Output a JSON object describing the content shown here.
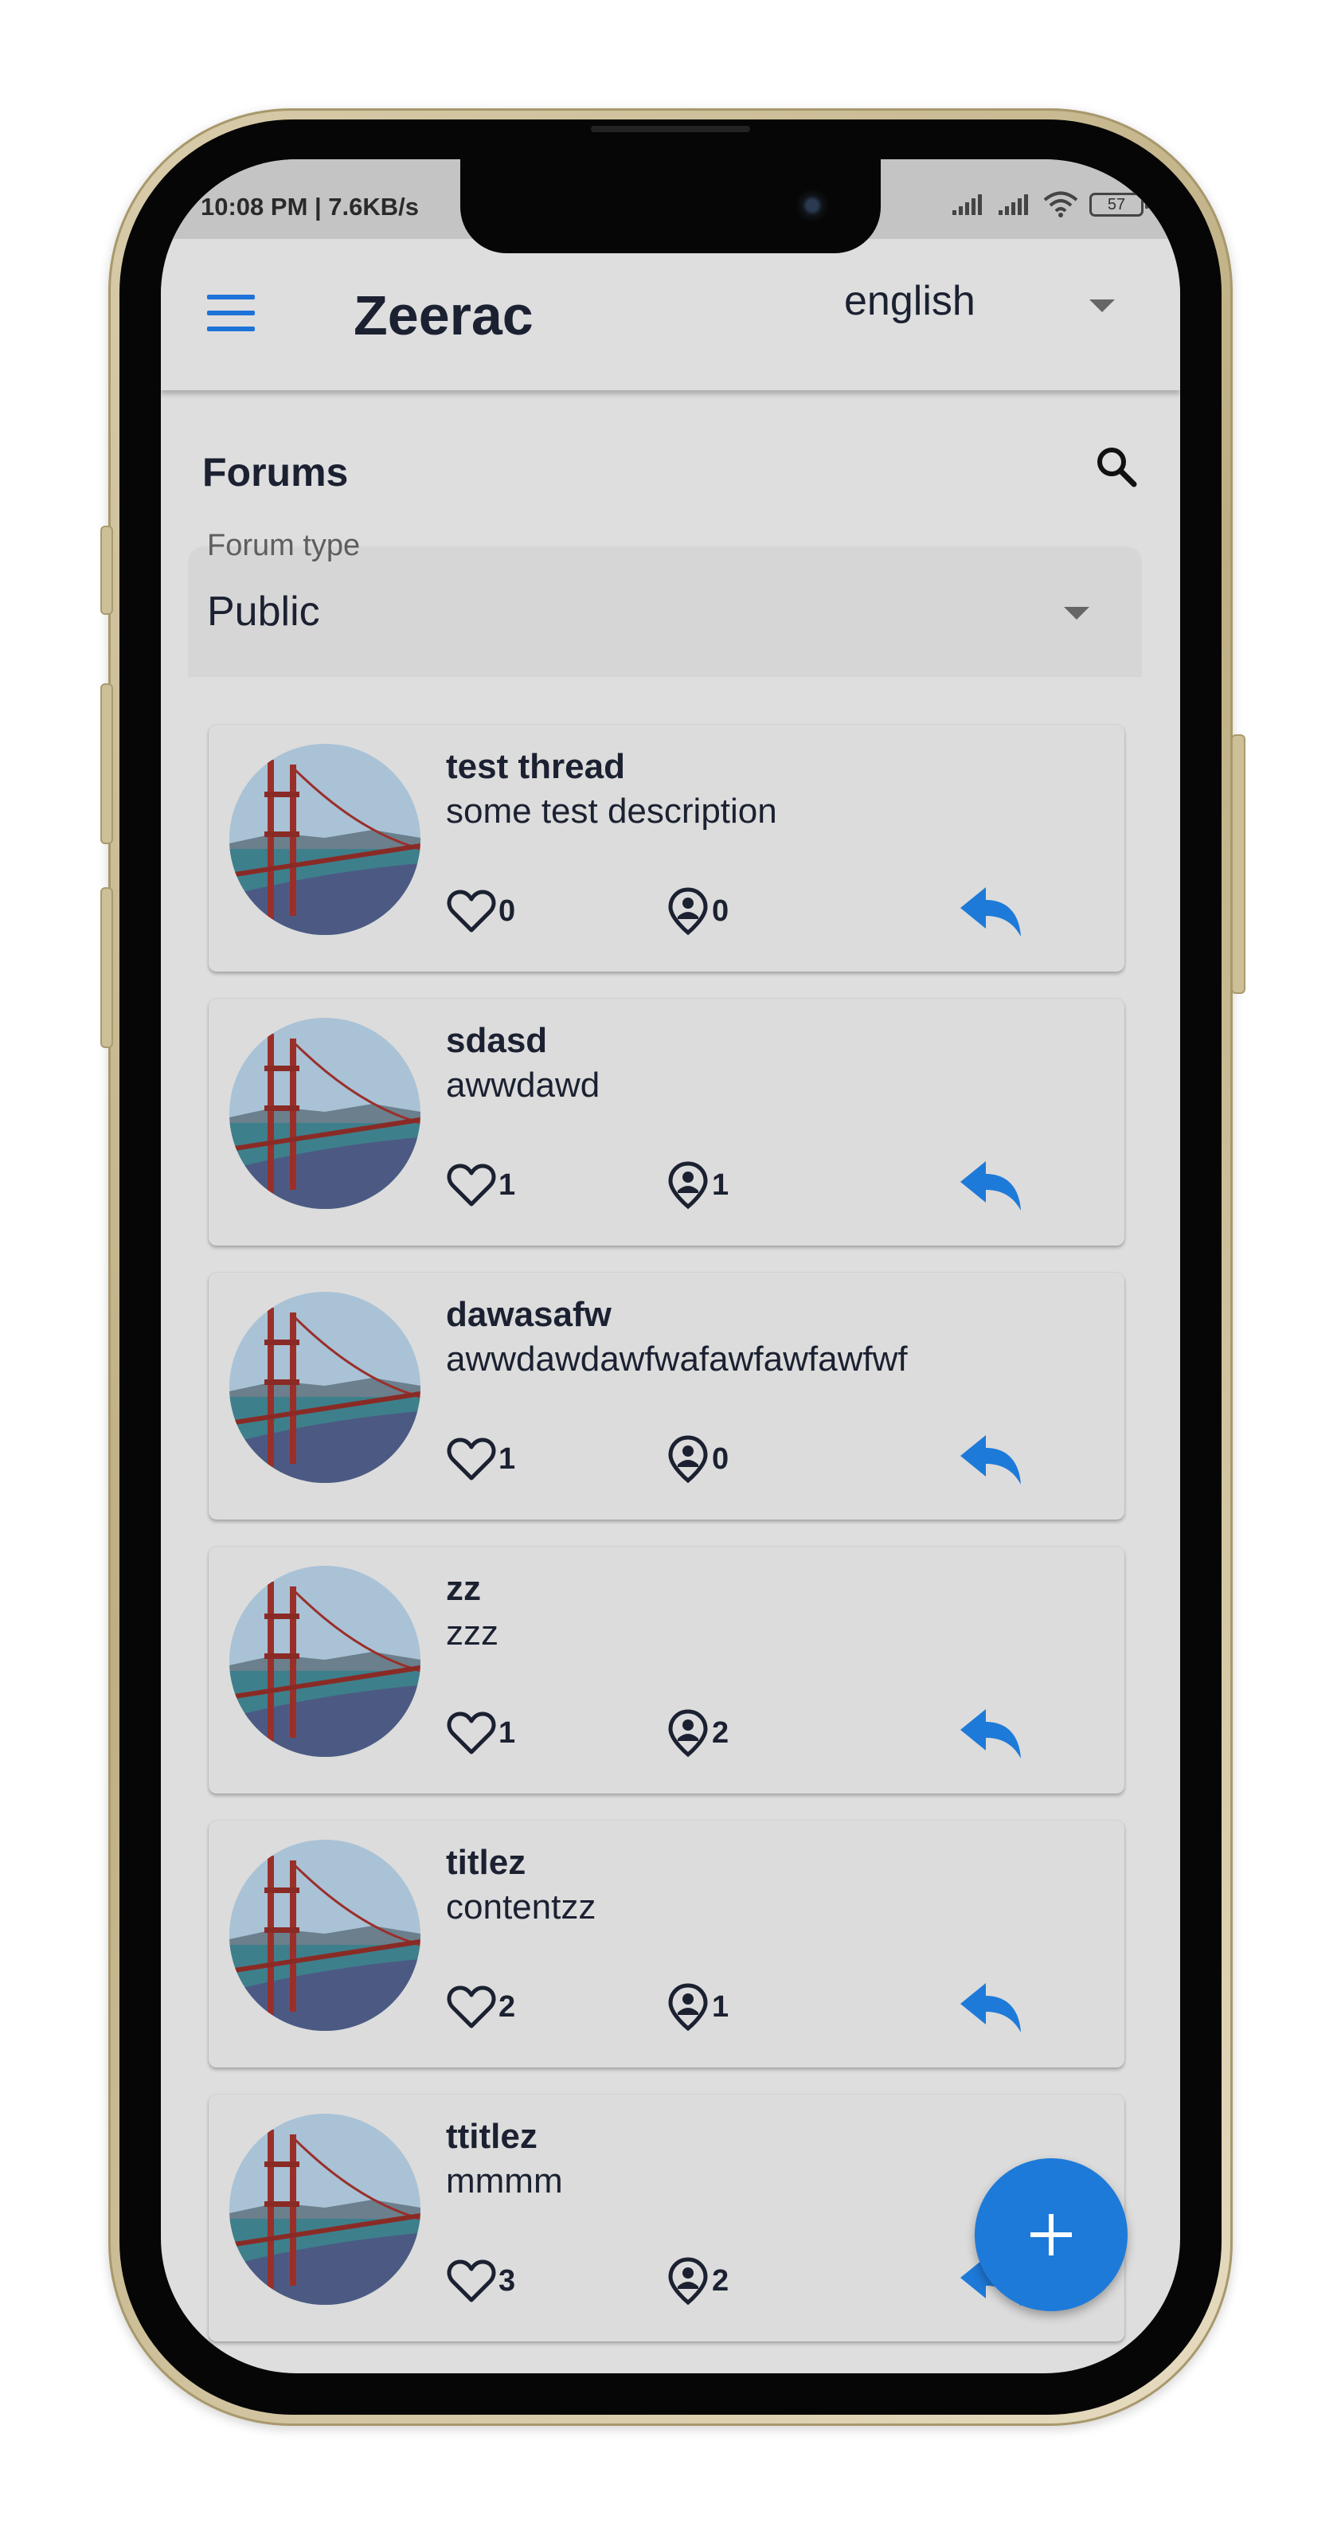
{
  "status_bar": {
    "time_speed": "10:08 PM | 7.6KB/s",
    "battery": "57"
  },
  "app_bar": {
    "title": "Zeerac",
    "language": "english"
  },
  "forums": {
    "title": "Forums",
    "forum_type_label": "Forum type",
    "forum_type_value": "Public"
  },
  "threads": [
    {
      "title": "test thread",
      "description": "some test description",
      "likes": "0",
      "members": "0"
    },
    {
      "title": "sdasd",
      "description": "awwdawd",
      "likes": "1",
      "members": "1"
    },
    {
      "title": "dawasafw",
      "description": "awwdawdawfwafawfawfawfwf",
      "likes": "1",
      "members": "0"
    },
    {
      "title": "zz",
      "description": "zzz",
      "likes": "1",
      "members": "2"
    },
    {
      "title": "titlez",
      "description": "contentzz",
      "likes": "2",
      "members": "1"
    },
    {
      "title": "ttitlez",
      "description": "mmmm",
      "likes": "3",
      "members": "2"
    }
  ],
  "colors": {
    "accent": "#1e7ad8",
    "text": "#1b2131",
    "background": "#dedede"
  },
  "icons": {
    "menu": "hamburger-menu-icon",
    "search": "search-icon",
    "like": "heart-outline-icon",
    "members": "person-pin-icon",
    "reply": "reply-arrow-icon",
    "add": "plus-icon"
  }
}
